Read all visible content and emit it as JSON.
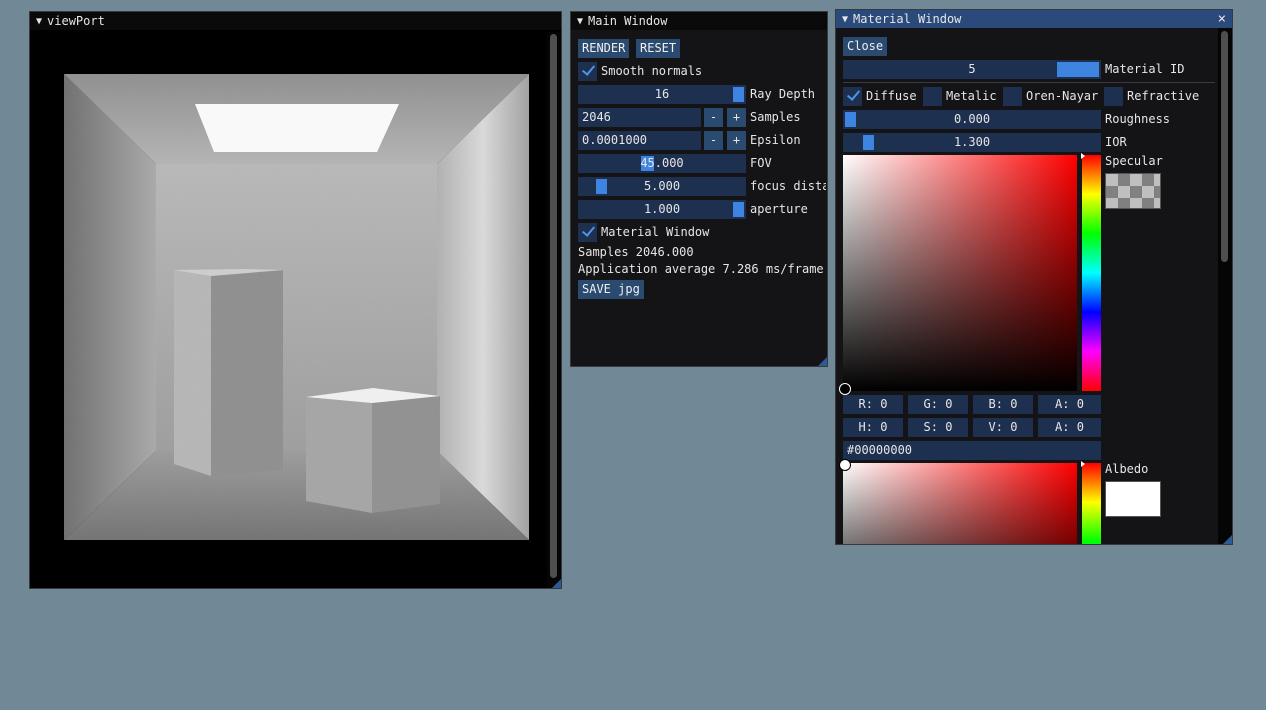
{
  "viewport": {
    "title": "viewPort"
  },
  "main_window": {
    "title": "Main Window",
    "render_label": "RENDER",
    "reset_label": "RESET",
    "smooth_normals_label": "Smooth normals",
    "smooth_normals_checked": true,
    "ray_depth": {
      "value": "16",
      "label": "Ray Depth"
    },
    "samples": {
      "value": "2046",
      "label": "Samples"
    },
    "epsilon": {
      "value": "0.0001000",
      "label": "Epsilon"
    },
    "fov": {
      "value": "45.000",
      "label": "FOV"
    },
    "focus_distance": {
      "value": "5.000",
      "label": "focus dista"
    },
    "aperture": {
      "value": "1.000",
      "label": "aperture"
    },
    "stepper_minus": "-",
    "stepper_plus": "+",
    "material_window_label": "Material Window",
    "material_window_checked": true,
    "samples_readout": "Samples 2046.000",
    "average_readout": "Application average 7.286 ms/frame",
    "save_label": "SAVE jpg"
  },
  "material_window": {
    "title": "Material Window",
    "close_icon": "×",
    "close_label": "Close",
    "material_id": {
      "value": "5",
      "label": "Material ID"
    },
    "types": [
      {
        "label": "Diffuse",
        "checked": true
      },
      {
        "label": "Metalic",
        "checked": false
      },
      {
        "label": "Oren-Nayar",
        "checked": false
      },
      {
        "label": "Refractive",
        "checked": false
      }
    ],
    "roughness": {
      "value": "0.000",
      "label": "Roughness"
    },
    "ior": {
      "value": "1.300",
      "label": "IOR"
    },
    "specular_label": "Specular",
    "rgba": {
      "r": "R:  0",
      "g": "G:  0",
      "b": "B:  0",
      "a": "A:  0"
    },
    "hsva": {
      "h": "H:  0",
      "s": "S:  0",
      "v": "V:  0",
      "a": "A:  0"
    },
    "hex": "#00000000",
    "albedo_label": "Albedo"
  },
  "colors": {
    "accent": "#3d85e0",
    "frame": "#1e3050",
    "button": "#2b4a6f",
    "background": "#718896"
  }
}
